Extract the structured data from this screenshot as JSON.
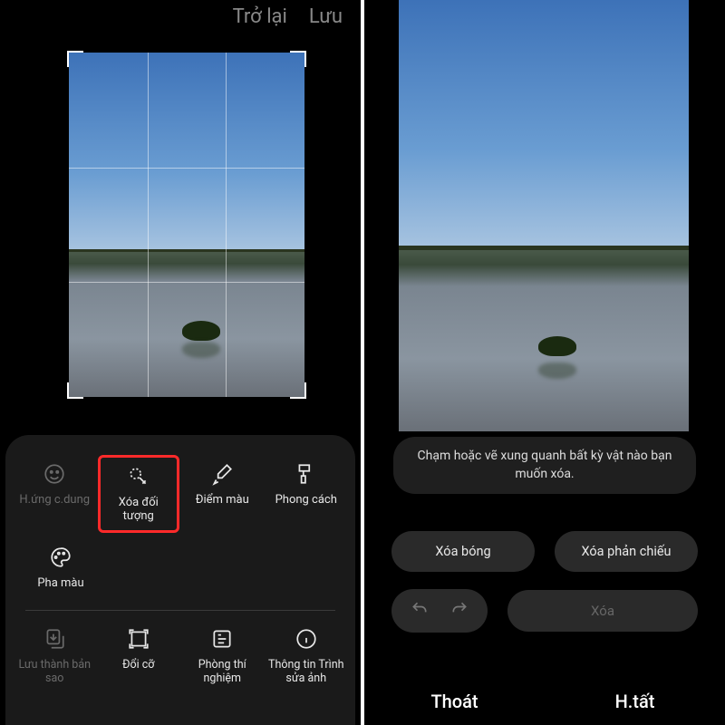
{
  "left": {
    "header": {
      "back": "Trở lại",
      "save": "Lưu"
    },
    "tools_row1": [
      {
        "label": "H.ứng c.dung",
        "icon": "face-icon",
        "dim": true
      },
      {
        "label": "Xóa đối tượng",
        "icon": "erase-object-icon",
        "highlight": true
      },
      {
        "label": "Điểm màu",
        "icon": "eyedropper-icon"
      },
      {
        "label": "Phong cách",
        "icon": "style-brush-icon"
      }
    ],
    "tools_row2": [
      {
        "label": "Pha màu",
        "icon": "palette-icon"
      }
    ],
    "tools_row3": [
      {
        "label": "Lưu thành bản sao",
        "icon": "save-copy-icon",
        "dim": true
      },
      {
        "label": "Đổi cỡ",
        "icon": "resize-icon"
      },
      {
        "label": "Phòng thí nghiệm",
        "icon": "lab-icon"
      },
      {
        "label": "Thông tin Trình sửa ảnh",
        "icon": "info-icon"
      }
    ]
  },
  "right": {
    "tip": "Chạm hoặc vẽ xung quanh bất kỳ vật nào bạn muốn xóa.",
    "option1": "Xóa bóng",
    "option2": "Xóa phản chiếu",
    "delete": "Xóa",
    "exit": "Thoát",
    "done": "H.tất"
  }
}
